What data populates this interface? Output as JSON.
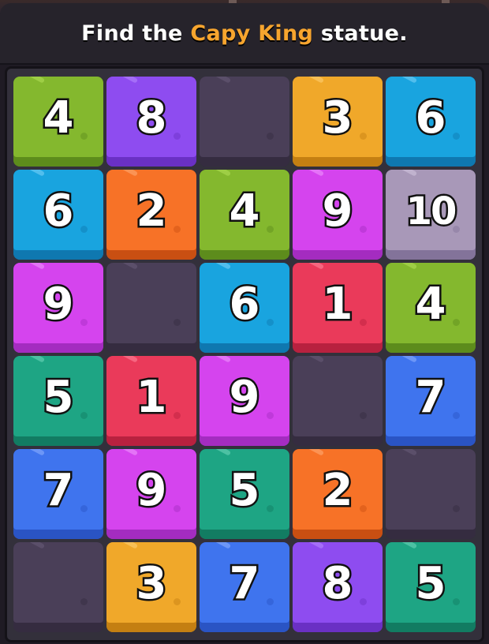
{
  "header": {
    "prefix": "Find the ",
    "highlight": "Capy King",
    "suffix": " statue."
  },
  "board": {
    "rows": [
      [
        {
          "n": "4",
          "color": "green"
        },
        {
          "n": "8",
          "color": "purple"
        },
        {
          "n": "",
          "color": "empty"
        },
        {
          "n": "3",
          "color": "orange"
        },
        {
          "n": "6",
          "color": "cyan"
        }
      ],
      [
        {
          "n": "6",
          "color": "cyan"
        },
        {
          "n": "2",
          "color": "tangerine"
        },
        {
          "n": "4",
          "color": "green"
        },
        {
          "n": "9",
          "color": "magenta"
        },
        {
          "n": "10",
          "color": "lavender"
        }
      ],
      [
        {
          "n": "9",
          "color": "magenta"
        },
        {
          "n": "",
          "color": "empty"
        },
        {
          "n": "6",
          "color": "cyan"
        },
        {
          "n": "1",
          "color": "red"
        },
        {
          "n": "4",
          "color": "green"
        }
      ],
      [
        {
          "n": "5",
          "color": "teal"
        },
        {
          "n": "1",
          "color": "red"
        },
        {
          "n": "9",
          "color": "magenta"
        },
        {
          "n": "",
          "color": "empty"
        },
        {
          "n": "7",
          "color": "blue"
        }
      ],
      [
        {
          "n": "7",
          "color": "blue"
        },
        {
          "n": "9",
          "color": "magenta"
        },
        {
          "n": "5",
          "color": "teal"
        },
        {
          "n": "2",
          "color": "tangerine"
        },
        {
          "n": "",
          "color": "empty"
        }
      ],
      [
        {
          "n": "",
          "color": "empty"
        },
        {
          "n": "3",
          "color": "orange"
        },
        {
          "n": "7",
          "color": "blue"
        },
        {
          "n": "8",
          "color": "purple"
        },
        {
          "n": "5",
          "color": "teal"
        }
      ]
    ]
  },
  "palette": {
    "green": {
      "face": "#84b82e",
      "shade": "#5d8c1c",
      "notch": "#b4e05a"
    },
    "purple": {
      "face": "#8e4cf0",
      "shade": "#6a30c4",
      "notch": "#b88bff"
    },
    "orange": {
      "face": "#f0a82a",
      "shade": "#c47f12",
      "notch": "#ffd178"
    },
    "cyan": {
      "face": "#19a4df",
      "shade": "#0f78b0",
      "notch": "#7fd4f7"
    },
    "tangerine": {
      "face": "#f77227",
      "shade": "#c94f12",
      "notch": "#ffae7a"
    },
    "magenta": {
      "face": "#d544ee",
      "shade": "#a42cc0",
      "notch": "#f09aff"
    },
    "lavender": {
      "face": "#a898b8",
      "shade": "#83739a",
      "notch": "#d4c8e0"
    },
    "red": {
      "face": "#ea3a5a",
      "shade": "#b8213f",
      "notch": "#ff8aa0"
    },
    "teal": {
      "face": "#1ea584",
      "shade": "#127c62",
      "notch": "#72d9bd"
    },
    "blue": {
      "face": "#3f74ee",
      "shade": "#2a54c4",
      "notch": "#92b2ff"
    },
    "empty": {
      "face": "#4a3f58",
      "shade": "#352c40",
      "notch": "#6a5c7a"
    }
  }
}
